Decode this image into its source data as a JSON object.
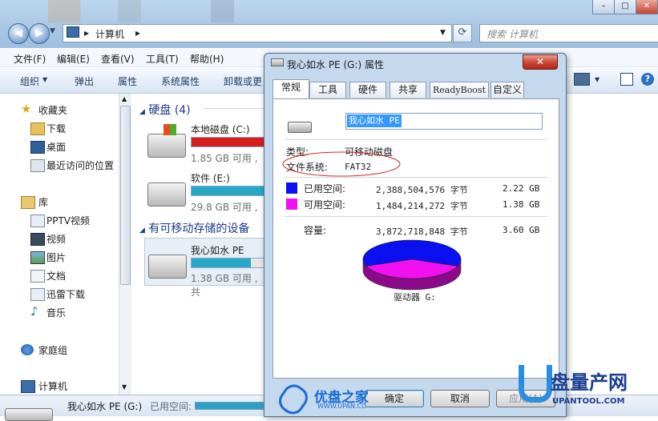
{
  "explorer": {
    "address": {
      "root": "计算机"
    },
    "search_placeholder": "搜索 计算机",
    "menu": [
      "文件(F)",
      "编辑(E)",
      "查看(V)",
      "工具(T)",
      "帮助(H)"
    ],
    "toolbar": [
      "组织",
      "弹出",
      "属性",
      "系统属性",
      "卸载或更"
    ],
    "sidebar": {
      "favorites": "收藏夹",
      "fav_items": [
        "下载",
        "桌面",
        "最近访问的位置"
      ],
      "library": "库",
      "lib_items": [
        "PPTV视频",
        "视频",
        "图片",
        "文档",
        "迅雷下载",
        "音乐"
      ],
      "homegroup": "家庭组",
      "computer": "计算机"
    },
    "sections": {
      "hard_disks": "硬盘 (4)",
      "removable": "有可移动存储的设备"
    },
    "drives": [
      {
        "name": "本地磁盘 (C:)",
        "free": "1.85 GB 可用 ,",
        "color": "#d62020",
        "used_fraction": 0.92
      },
      {
        "name": "软件 (E:)",
        "free": "29.8 GB 可用 ,",
        "color": "#27a8c8",
        "used_fraction": 0.85
      },
      {
        "name": "我心如水 PE (G:)",
        "free": "1.38 GB 可用 , 共",
        "color": "#27a8c8",
        "used_fraction": 0.62
      }
    ],
    "status": {
      "name": "我心如水 PE (G:)",
      "used_label": "已用空间:"
    }
  },
  "dialog": {
    "title": "我心如水 PE (G:) 属性",
    "close_label": "✕",
    "tabs": [
      "常规",
      "工具",
      "硬件",
      "共享",
      "ReadyBoost",
      "自定义"
    ],
    "volume_label": "我心如水 PE",
    "type_label": "类型:",
    "type_value": "可移动磁盘",
    "fs_label": "文件系统:",
    "fs_value": "FAT32",
    "used": {
      "label": "已用空间:",
      "bytes": "2,388,504,576 字节",
      "gb": "2.22 GB",
      "color": "#0a10f0"
    },
    "free": {
      "label": "可用空间:",
      "bytes": "1,484,214,272 字节",
      "gb": "1.38 GB",
      "color": "#f010f0"
    },
    "capacity": {
      "label": "容量:",
      "bytes": "3,872,718,848 字节",
      "gb": "3.60 GB"
    },
    "drive_label": "驱动器 G:",
    "buttons": {
      "ok": "确定",
      "cancel": "取消",
      "apply": "应用(A)"
    },
    "used_fraction": 0.617
  },
  "watermarks": {
    "left_brand": "优盘之家",
    "left_url": "WWW.UPAN.CC",
    "right_brand": "盘量产网",
    "right_url": "UPANTOOL.COM"
  }
}
